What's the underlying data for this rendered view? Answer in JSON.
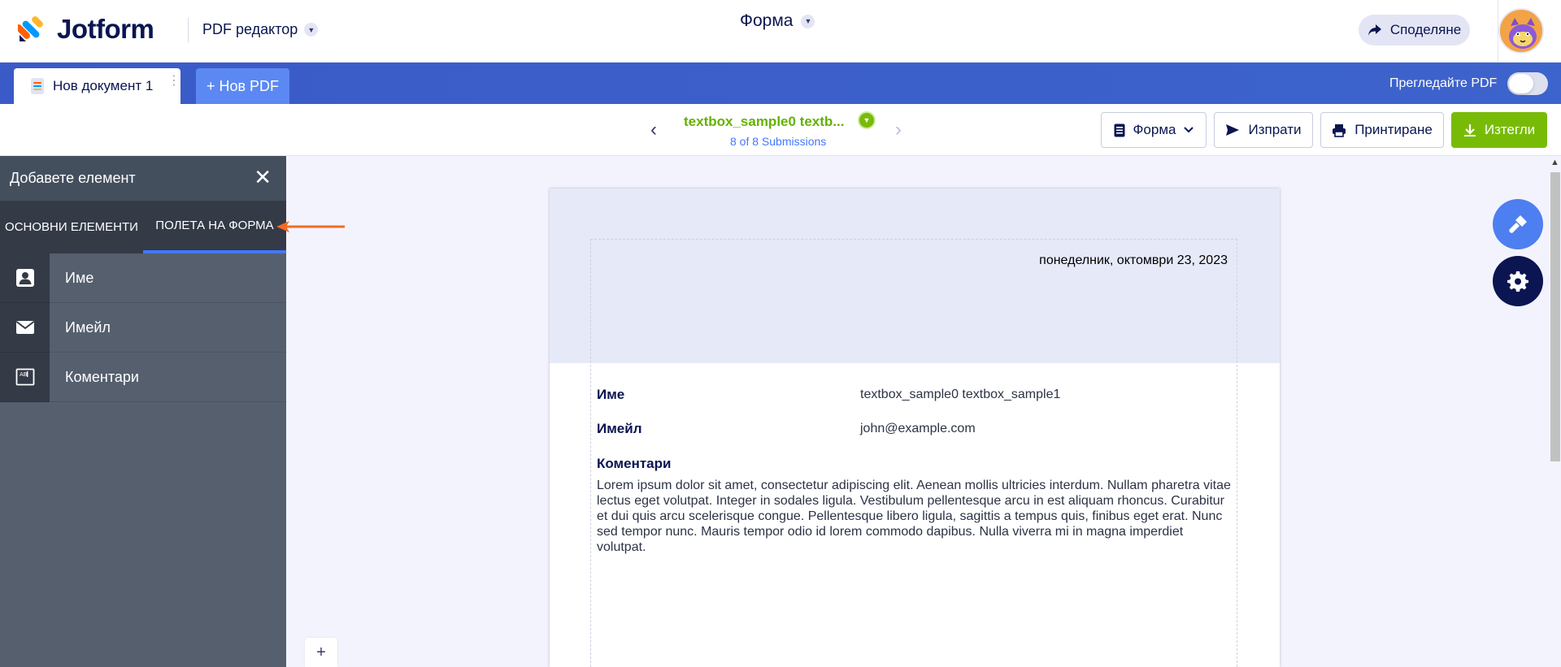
{
  "header": {
    "logo_text": "Jotform",
    "product_label": "PDF редактор",
    "form_title": "Форма",
    "share_label": "Споделяне"
  },
  "tabs": {
    "document_tab": "Нов документ 1",
    "new_pdf": "+ Нов PDF",
    "preview_label": "Прегледайте PDF",
    "preview_enabled": false
  },
  "submission": {
    "name": "textbox_sample0 textb...",
    "count": "8 of 8 Submissions",
    "buttons": {
      "form": "Форма",
      "send": "Изпрати",
      "print": "Принтиране",
      "download": "Изтегли"
    }
  },
  "panel": {
    "title": "Добавете елемент",
    "tabs": [
      "ОСНОВНИ ЕЛЕМЕНТИ",
      "ПОЛЕТА НА ФОРМА"
    ],
    "active_tab": "ПОЛЕТА НА ФОРМА",
    "items": [
      {
        "label": "Име",
        "icon": "contact-card-icon"
      },
      {
        "label": "Имейл",
        "icon": "envelope-icon"
      },
      {
        "label": "Коментари",
        "icon": "textbox-icon"
      }
    ]
  },
  "canvas": {
    "zoom_button": "+"
  },
  "page": {
    "date": "понеделник, октомври 23, 2023",
    "fields": [
      {
        "label": "Име",
        "value": "textbox_sample0 textbox_sample1"
      },
      {
        "label": "Имейл",
        "value": "john@example.com"
      }
    ],
    "comments_label": "Коментари",
    "comments_text": "Lorem ipsum dolor sit amet, consectetur adipiscing elit. Aenean mollis ultricies interdum. Nullam pharetra vitae lectus eget volutpat. Integer in sodales ligula. Vestibulum pellentesque arcu in est aliquam rhoncus. Curabitur et dui quis arcu scelerisque congue. Pellentesque libero ligula, sagittis a tempus quis, finibus eget erat. Nunc sed tempor nunc. Mauris tempor odio id lorem commodo dapibus. Nulla viverra mi in magna imperdiet volutpat."
  },
  "colors": {
    "brand_blue": "#3b5fc8",
    "accent_green": "#78bb07",
    "panel_bg": "#555f6e",
    "navy": "#0a1551",
    "arrow": "#f26a21"
  }
}
